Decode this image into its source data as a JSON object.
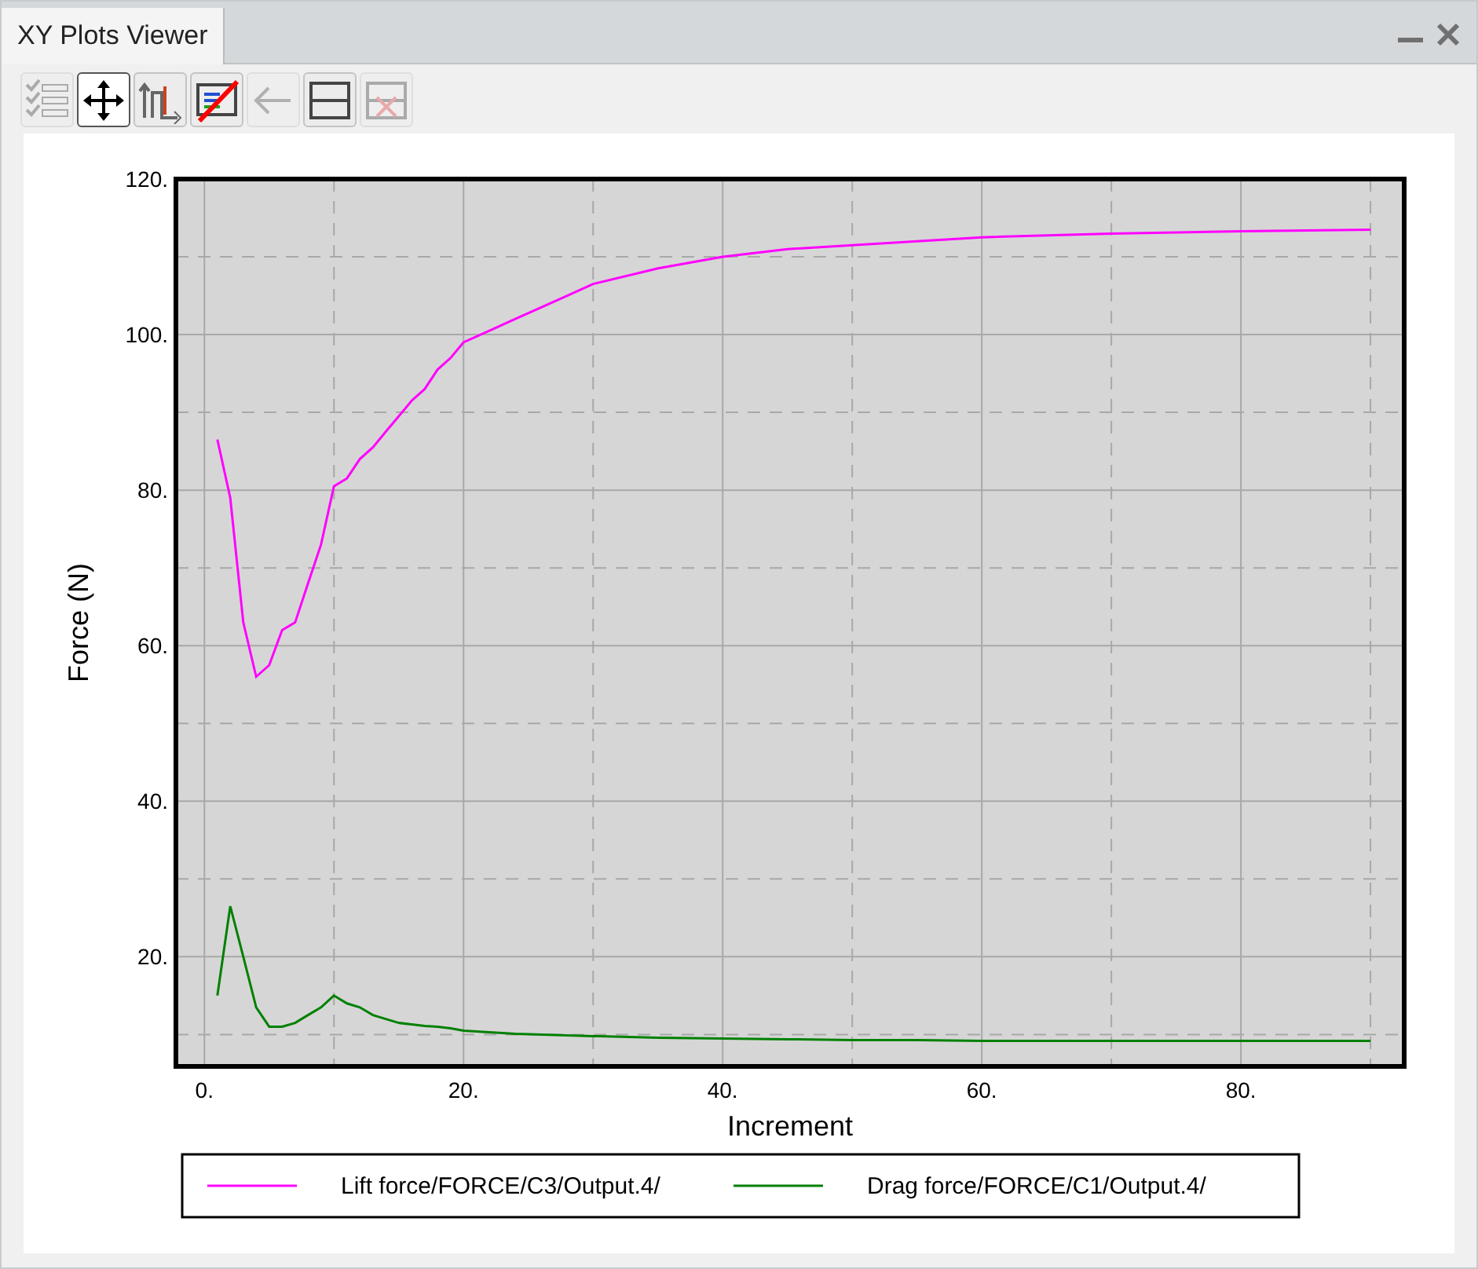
{
  "window": {
    "tab": {
      "title": "XY Plots Viewer",
      "selected": true
    }
  },
  "toolbar": [
    {
      "selected": false,
      "disabled": true
    },
    {
      "selected": true,
      "disabled": false
    },
    {
      "selected": false,
      "disabled": false
    },
    {
      "selected": false,
      "disabled": false
    },
    {
      "selected": false,
      "disabled": true
    },
    {
      "selected": false,
      "disabled": false
    },
    {
      "selected": false,
      "disabled": true
    }
  ],
  "plot": {
    "chart_data": {
      "type": "line",
      "xlabel": "Increment",
      "ylabel": "Force (N)",
      "x": [
        1,
        2,
        3,
        4,
        5,
        6,
        7,
        8,
        9,
        10,
        11,
        12,
        13,
        14,
        15,
        16,
        17,
        18,
        19,
        20,
        22,
        24,
        26,
        28,
        30,
        35,
        40,
        45,
        50,
        55,
        60,
        70,
        80,
        90
      ],
      "series": [
        {
          "name": "Lift force/FORCE/C3/Output.4/",
          "color": "#ff00ff",
          "values": [
            86.5,
            79,
            63,
            56,
            57.5,
            62,
            63,
            68,
            73,
            80.5,
            81.5,
            84,
            85.5,
            87.5,
            89.5,
            91.5,
            93,
            95.5,
            97,
            99,
            100.5,
            102,
            103.5,
            105,
            106.5,
            108.5,
            110,
            111,
            111.5,
            112,
            112.5,
            113,
            113.3,
            113.5
          ]
        },
        {
          "name": "Drag force/FORCE/C1/Output.4/",
          "color": "#008000",
          "values": [
            15,
            26.5,
            20,
            13.5,
            11,
            11,
            11.5,
            12.5,
            13.5,
            15,
            14,
            13.5,
            12.5,
            12,
            11.5,
            11.3,
            11.1,
            11,
            10.8,
            10.5,
            10.3,
            10.1,
            10,
            9.9,
            9.8,
            9.6,
            9.5,
            9.4,
            9.3,
            9.3,
            9.2,
            9.2,
            9.2,
            9.2
          ]
        }
      ],
      "grid": true,
      "legend": true,
      "xlim": [
        -2.2,
        92.6
      ],
      "ylim": [
        5.9,
        120
      ],
      "xticks": [
        {
          "value": 0,
          "label": "0."
        },
        {
          "value": 20,
          "label": "20."
        },
        {
          "value": 40,
          "label": "40."
        },
        {
          "value": 60,
          "label": "60."
        },
        {
          "value": 80,
          "label": "80."
        }
      ],
      "yticks": [
        {
          "value": 20,
          "label": "20."
        },
        {
          "value": 40,
          "label": "40."
        },
        {
          "value": 60,
          "label": "60."
        },
        {
          "value": 80,
          "label": "80."
        },
        {
          "value": 100,
          "label": "100."
        },
        {
          "value": 120,
          "label": "120."
        }
      ]
    }
  }
}
